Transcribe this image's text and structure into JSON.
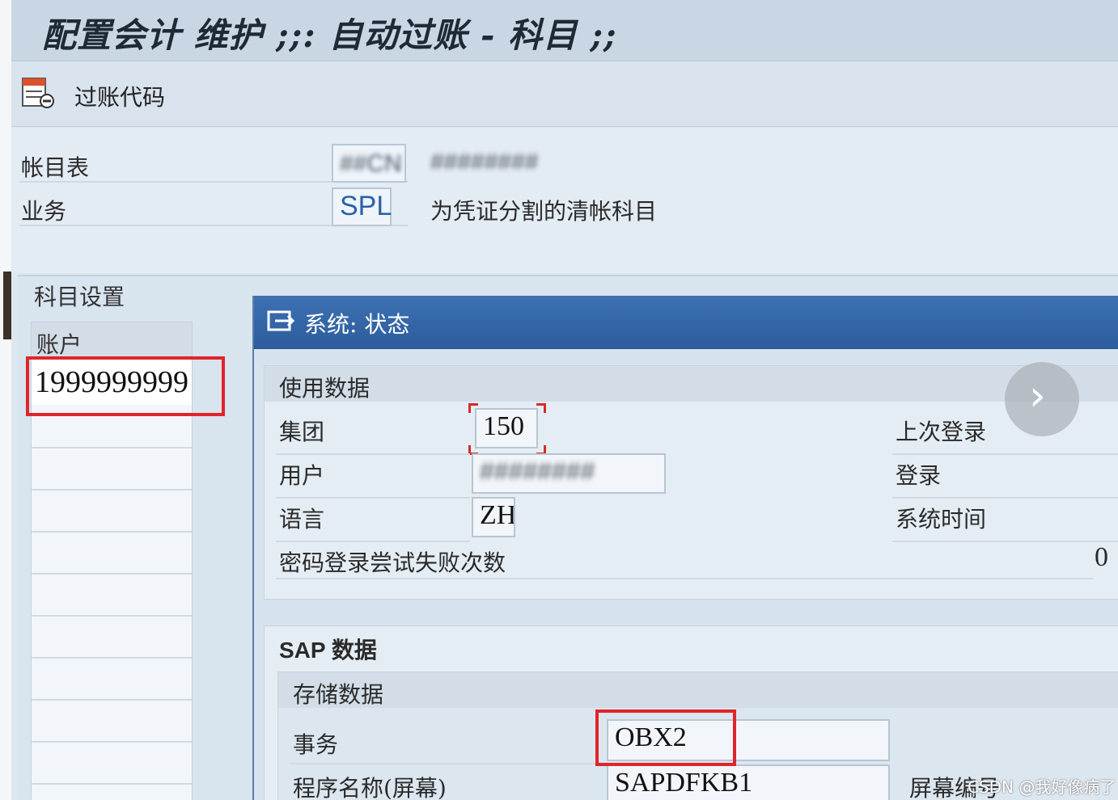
{
  "window": {
    "title": "配置会计 维护 ;;: 自动过账 - 科目 ;;"
  },
  "toolbar": {
    "posting_keys_label": "过账代码"
  },
  "header": {
    "chart_of_accounts_label": "帐目表",
    "chart_of_accounts_value": "##CN",
    "chart_of_accounts_desc": "########",
    "transaction_label": "业务",
    "transaction_value": "SPL",
    "transaction_desc": "为凭证分割的清帐科目"
  },
  "account_settings": {
    "title": "科目设置",
    "column_header": "账户",
    "rows": [
      "1999999999"
    ]
  },
  "dialog": {
    "title": "系统: 状态",
    "usage": {
      "title": "使用数据",
      "client_label": "集团",
      "client_value": "150",
      "user_label": "用户",
      "user_value": "########",
      "language_label": "语言",
      "language_value": "ZH",
      "failed_logins_label": "密码登录尝试失败次数",
      "failed_logins_value": "0",
      "last_logon_label": "上次登录",
      "logon_label": "登录",
      "system_time_label": "系统时间"
    },
    "sap_data": {
      "title": "SAP 数据",
      "repository": {
        "title": "存储数据",
        "transaction_label": "事务",
        "transaction_value": "OBX2",
        "program_label": "程序名称(屏幕)",
        "program_value": "SAPDFKB1",
        "screen_number_label": "屏幕编号"
      }
    }
  },
  "navigation": {
    "next_glyph": "›"
  },
  "watermark": "CSDN @我好像病了",
  "colors": {
    "title_bar": "#c9d7e4",
    "dialog_header": "#3d71b3",
    "highlight_red": "#e0242b",
    "field_value_blue": "#2a62a8"
  }
}
